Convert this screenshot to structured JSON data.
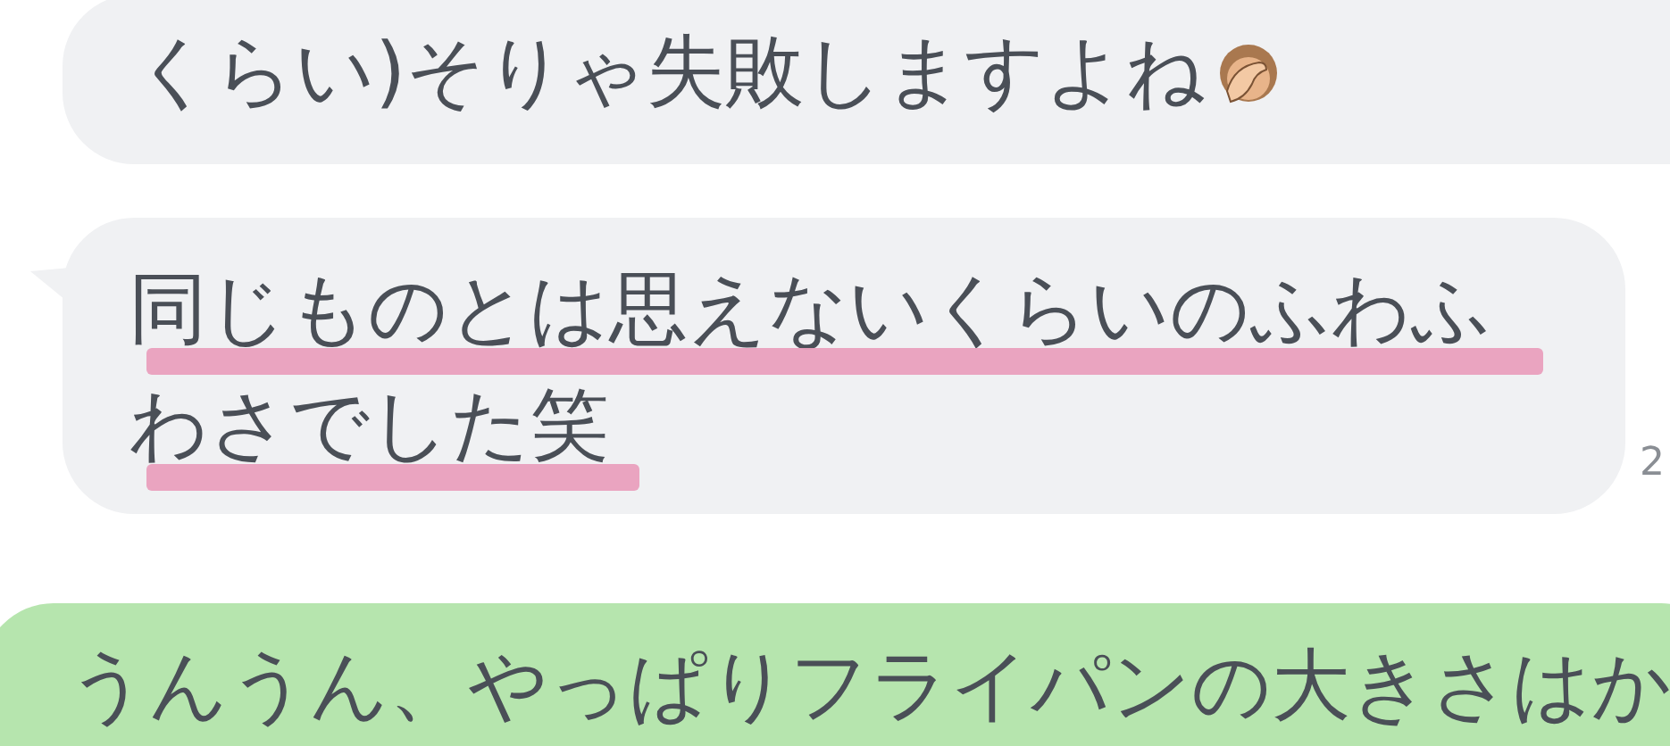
{
  "messages": [
    {
      "kind": "received",
      "tail": false,
      "lines": [
        {
          "text": "くらい)そりゃ失敗しますよね",
          "highlighted": false,
          "emoji": true
        }
      ]
    },
    {
      "kind": "received",
      "tail": true,
      "time": "2",
      "lines": [
        {
          "text": "同じものとは思えないくらいのふわふ",
          "highlighted": true
        },
        {
          "text": "わさでした笑",
          "highlighted": true
        }
      ]
    },
    {
      "kind": "sent",
      "tail": false,
      "lines": [
        {
          "text": "うんうん、やっぱりフライパンの大きさはか",
          "highlighted": false
        }
      ]
    }
  ]
}
